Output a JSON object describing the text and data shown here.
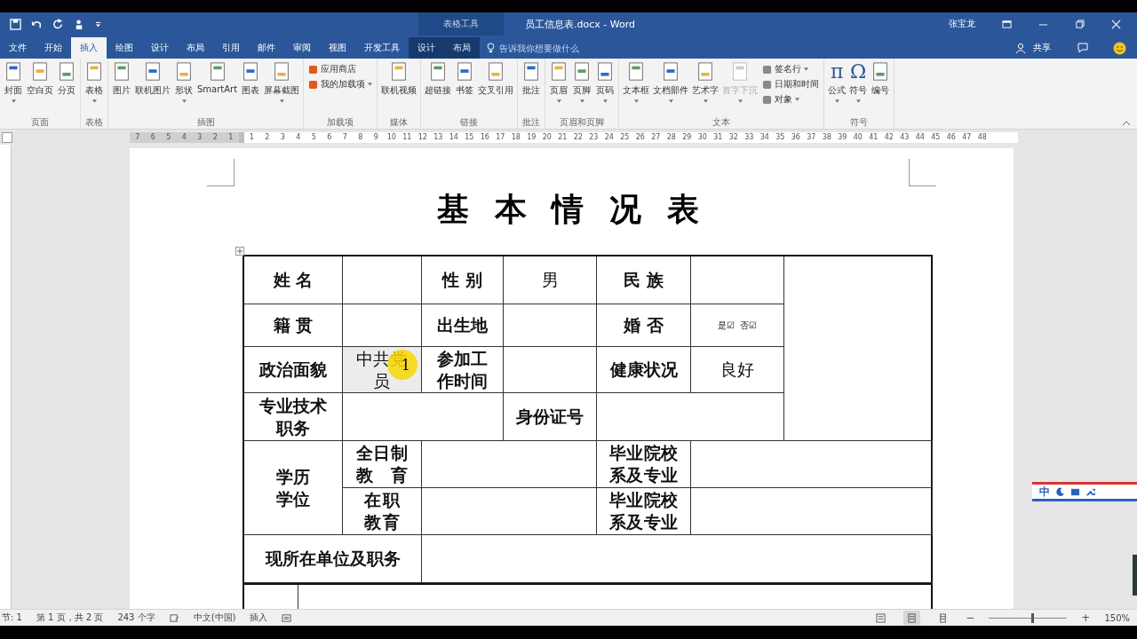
{
  "window": {
    "title": "员工信息表.docx - Word",
    "context_tab": "表格工具",
    "user": "张宝龙"
  },
  "quick_access": [
    {
      "kind": "save"
    },
    {
      "kind": "undo"
    },
    {
      "kind": "redo"
    },
    {
      "kind": "touch"
    }
  ],
  "tabs": [
    {
      "label": "文件",
      "selected": false,
      "contextual": false
    },
    {
      "label": "开始",
      "selected": false,
      "contextual": false
    },
    {
      "label": "插入",
      "selected": true,
      "contextual": false
    },
    {
      "label": "绘图",
      "selected": false,
      "contextual": false
    },
    {
      "label": "设计",
      "selected": false,
      "contextual": false
    },
    {
      "label": "布局",
      "selected": false,
      "contextual": false
    },
    {
      "label": "引用",
      "selected": false,
      "contextual": false
    },
    {
      "label": "邮件",
      "selected": false,
      "contextual": false
    },
    {
      "label": "审阅",
      "selected": false,
      "contextual": false
    },
    {
      "label": "视图",
      "selected": false,
      "contextual": false
    },
    {
      "label": "开发工具",
      "selected": false,
      "contextual": false
    },
    {
      "label": "设计",
      "selected": false,
      "contextual": true
    },
    {
      "label": "布局",
      "selected": false,
      "contextual": true
    }
  ],
  "tell_me": {
    "placeholder": "告诉我你想要做什么"
  },
  "share": "共享",
  "ribbon": {
    "groups": [
      {
        "label": "页面",
        "items": [
          {
            "label": "封面",
            "kind": "large",
            "dropdown": true,
            "disabled": false
          },
          {
            "label": "空白页",
            "kind": "large",
            "dropdown": false,
            "disabled": false
          },
          {
            "label": "分页",
            "kind": "large",
            "dropdown": false,
            "disabled": false
          }
        ]
      },
      {
        "label": "表格",
        "items": [
          {
            "label": "表格",
            "kind": "large",
            "dropdown": true,
            "disabled": false
          }
        ]
      },
      {
        "label": "插图",
        "items": [
          {
            "label": "图片",
            "kind": "large",
            "dropdown": false,
            "disabled": false
          },
          {
            "label": "联机图片",
            "kind": "large",
            "dropdown": false,
            "disabled": false
          },
          {
            "label": "形状",
            "kind": "large",
            "dropdown": true,
            "disabled": false
          },
          {
            "label": "SmartArt",
            "kind": "large",
            "dropdown": false,
            "disabled": false
          },
          {
            "label": "图表",
            "kind": "large",
            "dropdown": false,
            "disabled": false
          },
          {
            "label": "屏幕截图",
            "kind": "large",
            "dropdown": true,
            "disabled": false
          }
        ]
      },
      {
        "label": "加载项",
        "items": [
          {
            "label": "应用商店",
            "kind": "small",
            "dropdown": false,
            "disabled": false
          },
          {
            "label": "我的加载项",
            "kind": "small",
            "dropdown": true,
            "disabled": false
          }
        ]
      },
      {
        "label": "媒体",
        "items": [
          {
            "label": "联机视频",
            "kind": "large",
            "dropdown": false,
            "disabled": false
          }
        ]
      },
      {
        "label": "链接",
        "items": [
          {
            "label": "超链接",
            "kind": "large",
            "dropdown": false,
            "disabled": false
          },
          {
            "label": "书签",
            "kind": "large",
            "dropdown": false,
            "disabled": false
          },
          {
            "label": "交叉引用",
            "kind": "large",
            "dropdown": false,
            "disabled": false
          }
        ]
      },
      {
        "label": "批注",
        "items": [
          {
            "label": "批注",
            "kind": "large",
            "dropdown": false,
            "disabled": false
          }
        ]
      },
      {
        "label": "页眉和页脚",
        "items": [
          {
            "label": "页眉",
            "kind": "large",
            "dropdown": true,
            "disabled": false
          },
          {
            "label": "页脚",
            "kind": "large",
            "dropdown": true,
            "disabled": false
          },
          {
            "label": "页码",
            "kind": "large",
            "dropdown": true,
            "disabled": false
          }
        ]
      },
      {
        "label": "文本",
        "items": [
          {
            "label": "文本框",
            "kind": "large",
            "dropdown": true,
            "disabled": false
          },
          {
            "label": "文档部件",
            "kind": "large",
            "dropdown": true,
            "disabled": false
          },
          {
            "label": "艺术字",
            "kind": "large",
            "dropdown": true,
            "disabled": false
          },
          {
            "label": "首字下沉",
            "kind": "large",
            "dropdown": true,
            "disabled": true
          },
          {
            "label": "签名行",
            "kind": "small",
            "dropdown": true,
            "disabled": false
          },
          {
            "label": "日期和时间",
            "kind": "small",
            "dropdown": false,
            "disabled": false
          },
          {
            "label": "对象",
            "kind": "small",
            "dropdown": true,
            "disabled": false
          }
        ]
      },
      {
        "label": "符号",
        "items": [
          {
            "label": "公式",
            "kind": "glyph",
            "glyph": "π",
            "dropdown": true,
            "disabled": false
          },
          {
            "label": "符号",
            "kind": "glyph",
            "glyph": "Ω",
            "dropdown": true,
            "disabled": false
          },
          {
            "label": "编号",
            "kind": "large",
            "dropdown": false,
            "disabled": false
          }
        ]
      }
    ]
  },
  "ruler": {
    "left_labels": [
      "7",
      "6",
      "5",
      "4",
      "3",
      "2",
      "1"
    ],
    "labels": [
      "1",
      "2",
      "3",
      "4",
      "5",
      "6",
      "7",
      "8",
      "9",
      "10",
      "11",
      "12",
      "13",
      "14",
      "15",
      "16",
      "17",
      "18",
      "19",
      "20",
      "21",
      "22",
      "23",
      "24",
      "25",
      "26",
      "27",
      "28",
      "29",
      "30",
      "31",
      "32",
      "33",
      "34",
      "35",
      "36",
      "37",
      "38",
      "39",
      "40",
      "41",
      "42",
      "43",
      "44",
      "45",
      "46",
      "47",
      "48"
    ]
  },
  "document": {
    "heading": "基 本 情 况 表",
    "table": {
      "cells": [
        {
          "text": "姓 名",
          "kind": "label",
          "selected": false
        },
        {
          "text": "性 别",
          "kind": "label",
          "selected": false
        },
        {
          "text": "男",
          "kind": "value",
          "selected": false
        },
        {
          "text": "民 族",
          "kind": "label",
          "selected": false
        },
        {
          "text": "籍 贯",
          "kind": "label",
          "selected": false
        },
        {
          "text": "出生地",
          "kind": "label",
          "selected": false
        },
        {
          "text": "婚 否",
          "kind": "label",
          "selected": false
        },
        {
          "text": "是☑  否☑",
          "kind": "small",
          "selected": false
        },
        {
          "text": "政治面貌",
          "kind": "label",
          "selected": false
        },
        {
          "text": "中共党员",
          "kind": "value",
          "selected": true
        },
        {
          "text": "参加工作时间",
          "kind": "label",
          "selected": false
        },
        {
          "text": "健康状况",
          "kind": "label",
          "selected": false
        },
        {
          "text": "良好",
          "kind": "value",
          "selected": false
        },
        {
          "text": "专业技术职务",
          "kind": "label",
          "selected": false
        },
        {
          "text": "身份证号",
          "kind": "label",
          "selected": false
        },
        {
          "text": "学历学位",
          "kind": "label",
          "selected": false
        },
        {
          "text": "全日制教育",
          "kind": "justified",
          "selected": false
        },
        {
          "text": "毕业院校系及专业",
          "kind": "justified",
          "selected": false
        },
        {
          "text": "在职教育",
          "kind": "justified",
          "selected": false
        },
        {
          "text": "毕业院校系及专业",
          "kind": "justified",
          "selected": false
        },
        {
          "text": "现所在单位及职务",
          "kind": "label",
          "selected": false
        }
      ]
    },
    "click_indicator": "1"
  },
  "status_bar": {
    "section": "节: 1",
    "page": "第 1 页，共 2 页",
    "words": "243 个字",
    "language": "中文(中国)",
    "mode": "插入",
    "views": [
      {
        "selected": false
      },
      {
        "selected": true
      },
      {
        "selected": false
      }
    ],
    "zoom_out": "−",
    "zoom_in": "+",
    "zoom_slider": {
      "level": 0.55
    },
    "zoom": "150%"
  },
  "ime_bar": {
    "label": "中"
  }
}
